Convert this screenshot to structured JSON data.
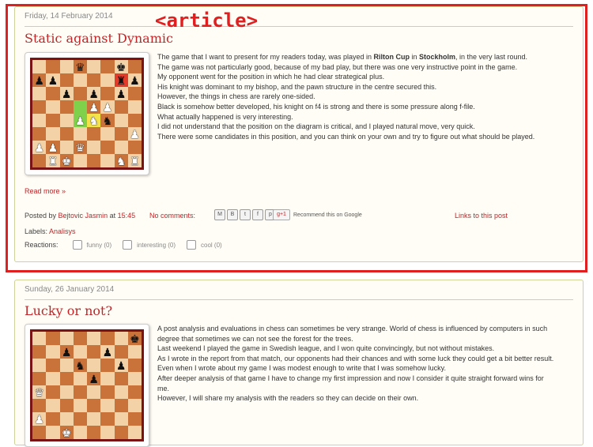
{
  "annotation": {
    "label": "<article>"
  },
  "post1": {
    "date": "Friday, 14 February 2014",
    "title": "Static against Dynamic",
    "paragraph_lines": [
      [
        "The game that I want to present for my readers today, was played in ",
        "Rilton Cup",
        " in ",
        "Stockholm",
        ", in the very last round."
      ],
      "The game was not particularly good, because of my bad play, but there was one very instructive point in the game.",
      "My opponent went for the position in which he had clear strategical plus.",
      "His knight was dominant to my bishop, and the pawn structure in the centre secured this.",
      "However, the things in chess are rarely one-sided.",
      "Black is somehow better developed, his knight on f4 is strong and there is some pressure along f-file.",
      "What actually happened is very interesting.",
      "I did not understand that the position on the diagram is critical, and I played natural move, very quick.",
      "There were some candidates in this position, and you can think on your own and try to figure out what should be played."
    ],
    "read_more": "Read more »",
    "posted_by_prefix": "Posted by",
    "author": "Bejtovic Jasmin",
    "at": "at",
    "time": "15:45",
    "comments": "No comments:",
    "share_buttons": [
      "M",
      "B",
      "t",
      "f",
      "p"
    ],
    "gplus": "g+1",
    "recommend": "Recommend this on Google",
    "links": "Links to this post",
    "labels_prefix": "Labels:",
    "label": "Analisys",
    "reactions_prefix": "Reactions:",
    "reactions": [
      "funny (0)",
      "interesting (0)",
      "cool (0)"
    ]
  },
  "post2": {
    "date": "Sunday, 26 January 2014",
    "title": "Lucky or not?",
    "paragraph_lines": [
      "A post analysis and evaluations in chess can sometimes  be very strange. World of chess is influenced by computers in such",
      "degree that sometimes we can not see the forest for the trees.",
      "Last weekend I played the game in Swedish league, and I won quite convincingly, but not without mistakes.",
      "As I wrote in the report from that match, our opponents had their chances and with some luck they could get a bit better result.",
      "Even when I wrote about my game I was modest enough to write that I was somehow lucky.",
      "After deeper analysis of that game I have to change my first impression and now I consider it quite straight forward wins for",
      "me.",
      "However, I will share my analysis with the readers so they can decide on their own."
    ]
  },
  "board1": [
    [
      "",
      "",
      "",
      "bq",
      "",
      "",
      "bk",
      ""
    ],
    [
      "bp",
      "bp",
      "",
      "",
      "",
      "",
      "br",
      "bp"
    ],
    [
      "",
      "",
      "bp",
      "",
      "bp",
      "",
      "bp",
      ""
    ],
    [
      "",
      "",
      "",
      "",
      "wp",
      "wp",
      "",
      ""
    ],
    [
      "",
      "",
      "",
      "wp",
      "wn",
      "bn",
      "",
      ""
    ],
    [
      "",
      "",
      "",
      "",
      "",
      "",
      "",
      "wp"
    ],
    [
      "wp",
      "wp",
      "",
      "wq",
      "",
      "",
      "",
      ""
    ],
    [
      "",
      "wr",
      "wk",
      "",
      "",
      "",
      "wn",
      "wr"
    ]
  ],
  "board1_colors": [
    "",
    "",
    "",
    "",
    "",
    "",
    "",
    "",
    "",
    "",
    "",
    "",
    "",
    "",
    "r",
    "",
    "",
    "",
    "",
    "",
    "",
    "",
    "",
    "",
    "",
    "",
    "",
    "g",
    "",
    "",
    "",
    "",
    "",
    "",
    "",
    "g",
    "y",
    "",
    "",
    "",
    "",
    "",
    "",
    "",
    "",
    "",
    "",
    "",
    "",
    "",
    "",
    "",
    "",
    "",
    "",
    "",
    "",
    "",
    "",
    "",
    "",
    "",
    "",
    ""
  ],
  "board2": [
    [
      "",
      "",
      "",
      "",
      "",
      "",
      "",
      "bk"
    ],
    [
      "",
      "",
      "bp",
      "",
      "",
      "bp",
      "",
      ""
    ],
    [
      "",
      "",
      "",
      "bn",
      "",
      "",
      "bp",
      ""
    ],
    [
      "",
      "",
      "",
      "",
      "bp",
      "",
      "",
      ""
    ],
    [
      "wq",
      "",
      "",
      "",
      "",
      "",
      "",
      ""
    ],
    [
      "",
      "",
      "",
      "",
      "",
      "",
      "",
      ""
    ],
    [
      "wp",
      "",
      "",
      "",
      "",
      "",
      "",
      ""
    ],
    [
      "",
      "",
      "wk",
      "",
      "",
      "",
      "",
      ""
    ]
  ]
}
